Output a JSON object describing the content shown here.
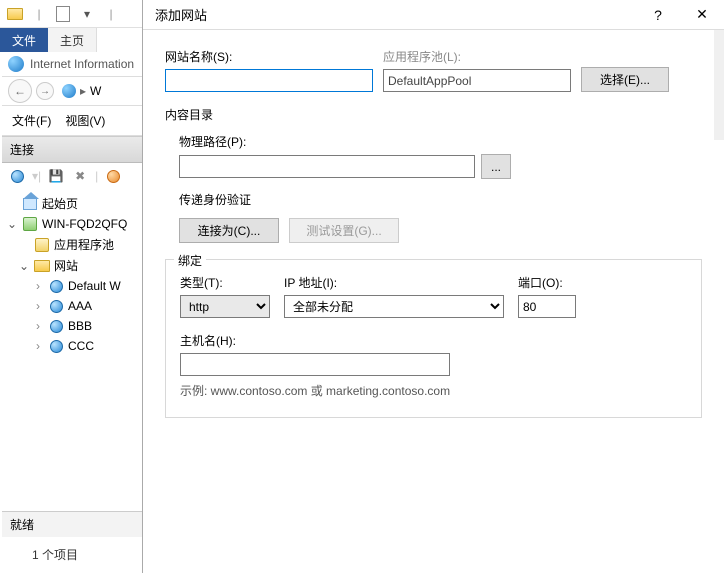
{
  "explorer": {
    "tabs": {
      "file": "文件",
      "home": "主页"
    }
  },
  "iis": {
    "title": "Internet Information",
    "breadcrumb_sep": "▸",
    "breadcrumb_text": "W",
    "menu": {
      "file": "文件(F)",
      "view": "视图(V)"
    },
    "connections_header": "连接",
    "tree": {
      "start_page": "起始页",
      "server": "WIN-FQD2QFQ",
      "app_pools": "应用程序池",
      "sites": "网站",
      "site_default": "Default W",
      "site_aaa": "AAA",
      "site_bbb": "BBB",
      "site_ccc": "CCC"
    },
    "status": "就绪",
    "item_count": "1 个项目"
  },
  "dialog": {
    "title": "添加网站",
    "help": "?",
    "close": "✕",
    "site_name_label": "网站名称(S):",
    "site_name_value": "",
    "app_pool_label": "应用程序池(L):",
    "app_pool_value": "DefaultAppPool",
    "select_btn": "选择(E)...",
    "content_dir_legend": "内容目录",
    "physical_path_label": "物理路径(P):",
    "physical_path_value": "",
    "browse_btn": "...",
    "passthrough_auth": "传递身份验证",
    "connect_as_btn": "连接为(C)...",
    "test_settings_btn": "测试设置(G)...",
    "binding_legend": "绑定",
    "type_label": "类型(T):",
    "type_value": "http",
    "ip_label": "IP 地址(I):",
    "ip_value": "全部未分配",
    "port_label": "端口(O):",
    "port_value": "80",
    "host_label": "主机名(H):",
    "host_value": "",
    "host_hint": "示例: www.contoso.com 或 marketing.contoso.com"
  }
}
